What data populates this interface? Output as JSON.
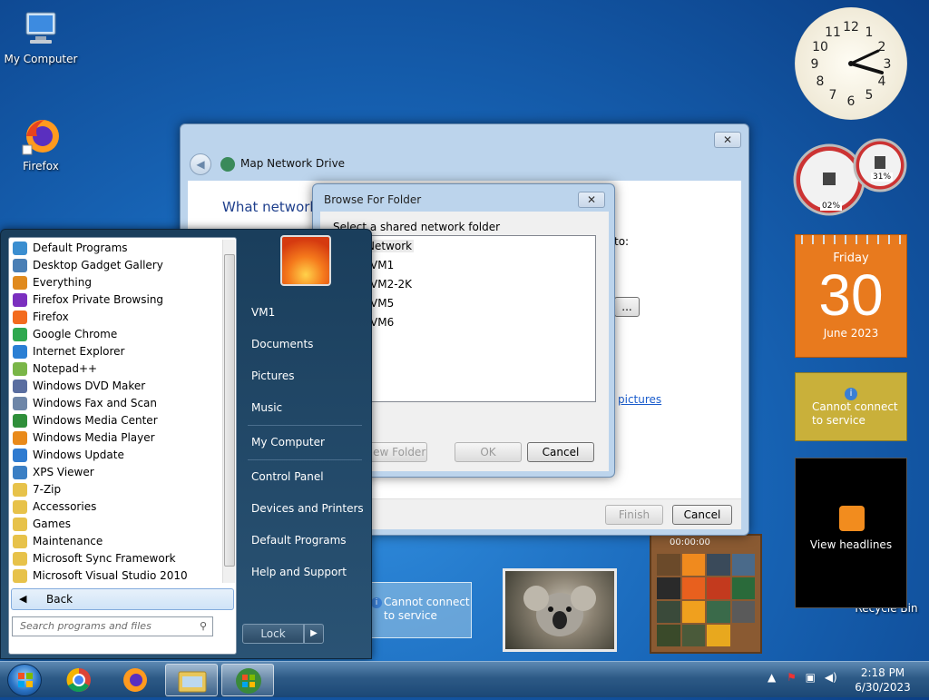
{
  "desktop": {
    "icons": [
      {
        "label": "My Computer"
      },
      {
        "label": "Firefox"
      },
      {
        "label": "Recycle Bin"
      }
    ]
  },
  "gadgets": {
    "calendar": {
      "dow": "Friday",
      "day": "30",
      "month": "June 2023"
    },
    "meter": {
      "cpu": "02%",
      "memory": "31%"
    },
    "weather": {
      "message": "Cannot connect to service"
    },
    "feeds": {
      "label": "View headlines"
    },
    "puzzle": {
      "timer": "00:00:00"
    }
  },
  "map_network_drive": {
    "title": "Map Network Drive",
    "heading": "What network",
    "partial_to": "to:",
    "partial_browse": "...",
    "partial_link": "pictures",
    "finish": "Finish",
    "cancel": "Cancel"
  },
  "browse_folder": {
    "title": "Browse For Folder",
    "instruction": "Select a shared network folder",
    "tree": [
      "Network",
      "VM1",
      "VM2-2K",
      "VM5",
      "VM6"
    ],
    "new_folder": "Make New Folder",
    "ok": "OK",
    "cancel": "Cancel"
  },
  "start_menu": {
    "programs": [
      {
        "label": "Default Programs",
        "color": "#3b8ed0"
      },
      {
        "label": "Desktop Gadget Gallery",
        "color": "#4a7fb5"
      },
      {
        "label": "Everything",
        "color": "#e08a1e"
      },
      {
        "label": "Firefox Private Browsing",
        "color": "#7b2fbf"
      },
      {
        "label": "Firefox",
        "color": "#f36b1e"
      },
      {
        "label": "Google Chrome",
        "color": "#2fa84f"
      },
      {
        "label": "Internet Explorer",
        "color": "#2a7fd4"
      },
      {
        "label": "Notepad++",
        "color": "#7ab648"
      },
      {
        "label": "Windows DVD Maker",
        "color": "#5a6ea0"
      },
      {
        "label": "Windows Fax and Scan",
        "color": "#6e86a8"
      },
      {
        "label": "Windows Media Center",
        "color": "#2f8f3a"
      },
      {
        "label": "Windows Media Player",
        "color": "#e98a1a"
      },
      {
        "label": "Windows Update",
        "color": "#2f7bd0"
      },
      {
        "label": "XPS Viewer",
        "color": "#3b7fc4"
      },
      {
        "label": "7-Zip",
        "color": "#e7c24a"
      },
      {
        "label": "Accessories",
        "color": "#e7c24a"
      },
      {
        "label": "Games",
        "color": "#e7c24a"
      },
      {
        "label": "Maintenance",
        "color": "#e7c24a"
      },
      {
        "label": "Microsoft Sync Framework",
        "color": "#e7c24a"
      },
      {
        "label": "Microsoft Visual Studio 2010",
        "color": "#e7c24a"
      }
    ],
    "back": "Back",
    "search_placeholder": "Search programs and files",
    "right": [
      "VM1",
      "Documents",
      "Pictures",
      "Music",
      "My Computer",
      "Control Panel",
      "Devices and Printers",
      "Default Programs",
      "Help and Support"
    ],
    "lock": "Lock"
  },
  "taskbar": {
    "time": "2:18 PM",
    "date": "6/30/2023"
  }
}
